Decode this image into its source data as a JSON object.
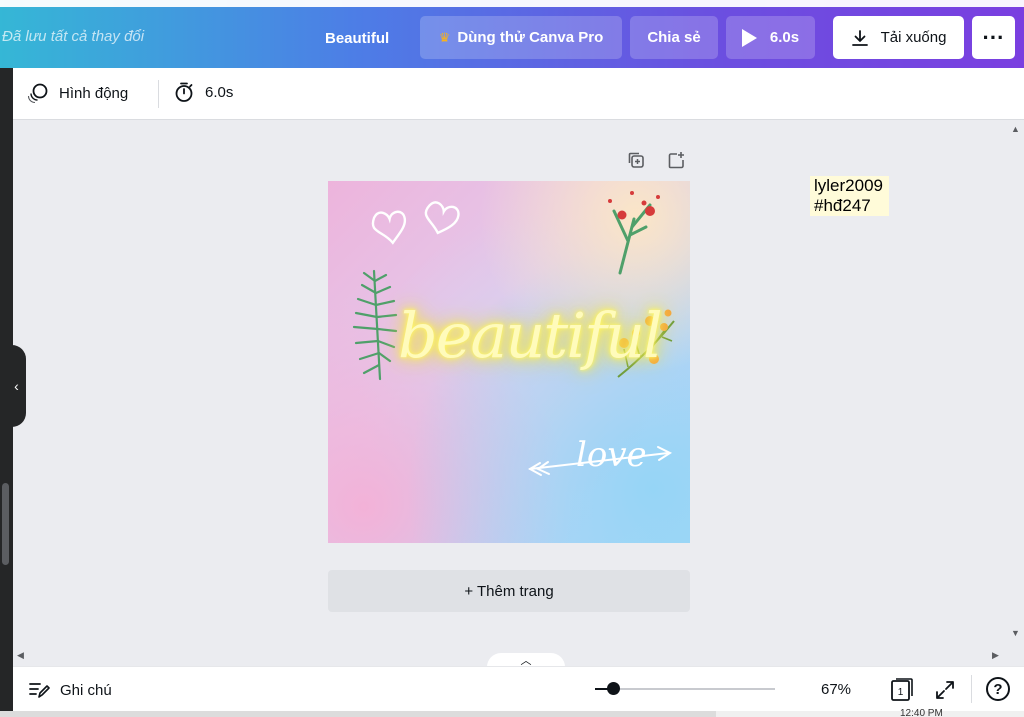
{
  "header": {
    "saved_status": "Đã lưu tất cả thay đổi",
    "doc_title": "Beautiful",
    "try_pro_label": "Dùng thử Canva Pro",
    "share_label": "Chia sẻ",
    "play_label": "6.0s",
    "download_label": "Tải xuống",
    "more_label": "···"
  },
  "toolbar": {
    "animation_label": "Hình động",
    "timing_label": "6.0s"
  },
  "canvas": {
    "neon_text": "beautiful",
    "love_text": "love",
    "add_page_label": "+ Thêm trang",
    "colors": {
      "neon": "#fff86a",
      "pink": "#edb4dc",
      "blue": "#a7d8f8",
      "leaf_green": "#4fa06a",
      "berry_red": "#d63b3b",
      "flower_orange": "#f4a340"
    }
  },
  "sticky_note": {
    "line1": "lyler2009",
    "line2": "#hđ247"
  },
  "footer": {
    "notes_label": "Ghi chú",
    "zoom_value": "67%",
    "zoom_fraction": 0.1,
    "page_count": "1",
    "help_label": "?"
  },
  "taskbar": {
    "clock": "12:40 PM"
  }
}
